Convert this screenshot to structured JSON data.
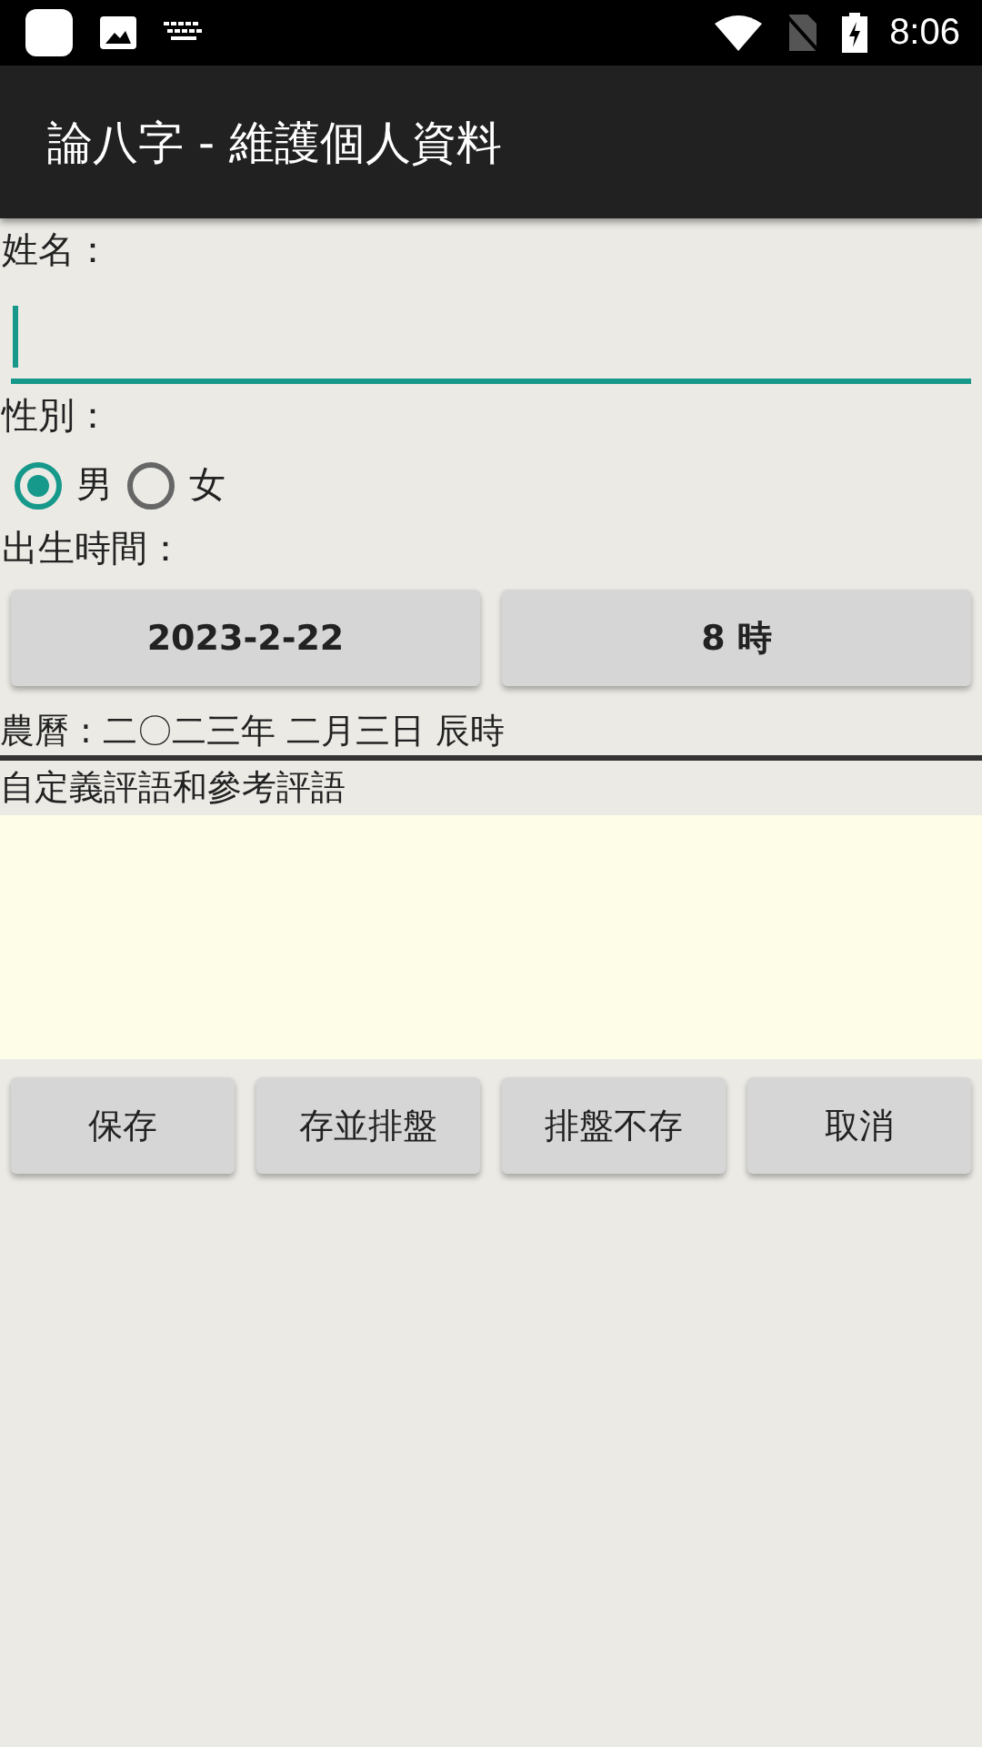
{
  "status_bar": {
    "time": "8:06"
  },
  "app_bar": {
    "title": "論八字 - 維護個人資料"
  },
  "name": {
    "label": "姓名：",
    "focused": true
  },
  "gender": {
    "label": "性別：",
    "options": [
      {
        "label": "男",
        "selected": true
      },
      {
        "label": "女",
        "selected": false
      }
    ]
  },
  "birth": {
    "label": "出生時間：",
    "date_button": "2023-2-22",
    "hour_button": "8 時"
  },
  "lunar": "農曆 : 二〇二三年 二月三日 辰時",
  "comments": {
    "label": "自定義評語和參考評語"
  },
  "buttons": [
    "保存",
    "存並排盤",
    "排盤不存",
    "取消"
  ]
}
